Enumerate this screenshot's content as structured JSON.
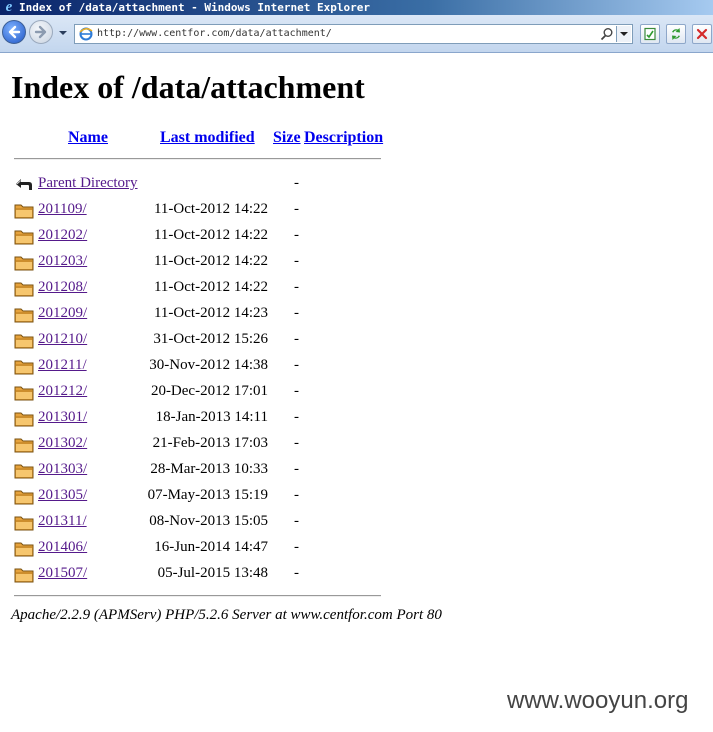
{
  "window": {
    "title": "Index of /data/attachment - Windows Internet Explorer",
    "url": "http://www.centfor.com/data/attachment/"
  },
  "page": {
    "heading": "Index of /data/attachment",
    "columns": {
      "name": "Name",
      "last_modified": "Last modified",
      "size": "Size",
      "description": "Description"
    },
    "parent": {
      "name": "Parent Directory",
      "size": "-"
    },
    "rows": [
      {
        "name": "201109/",
        "modified": "11-Oct-2012 14:22",
        "size": "-"
      },
      {
        "name": "201202/",
        "modified": "11-Oct-2012 14:22",
        "size": "-"
      },
      {
        "name": "201203/",
        "modified": "11-Oct-2012 14:22",
        "size": "-"
      },
      {
        "name": "201208/",
        "modified": "11-Oct-2012 14:22",
        "size": "-"
      },
      {
        "name": "201209/",
        "modified": "11-Oct-2012 14:23",
        "size": "-"
      },
      {
        "name": "201210/",
        "modified": "31-Oct-2012 15:26",
        "size": "-"
      },
      {
        "name": "201211/",
        "modified": "30-Nov-2012 14:38",
        "size": "-"
      },
      {
        "name": "201212/",
        "modified": "20-Dec-2012 17:01",
        "size": "-"
      },
      {
        "name": "201301/",
        "modified": "18-Jan-2013 14:11",
        "size": "-"
      },
      {
        "name": "201302/",
        "modified": "21-Feb-2013 17:03",
        "size": "-"
      },
      {
        "name": "201303/",
        "modified": "28-Mar-2013 10:33",
        "size": "-"
      },
      {
        "name": "201305/",
        "modified": "07-May-2013 15:19",
        "size": "-"
      },
      {
        "name": "201311/",
        "modified": "08-Nov-2013 15:05",
        "size": "-"
      },
      {
        "name": "201406/",
        "modified": "16-Jun-2014 14:47",
        "size": "-"
      },
      {
        "name": "201507/",
        "modified": "05-Jul-2015 13:48",
        "size": "-"
      }
    ],
    "footer": "Apache/2.2.9 (APMServ) PHP/5.2.6 Server at www.centfor.com Port 80"
  },
  "watermark": "www.wooyun.org",
  "icons": {
    "back": "back-arrow-icon",
    "forward": "forward-arrow-icon",
    "page": "ie-page-icon",
    "search": "search-icon",
    "refresh": "refresh-icon",
    "stop": "stop-icon",
    "compat": "compatibility-icon",
    "folder": "folder-icon",
    "parent": "parent-directory-icon"
  }
}
